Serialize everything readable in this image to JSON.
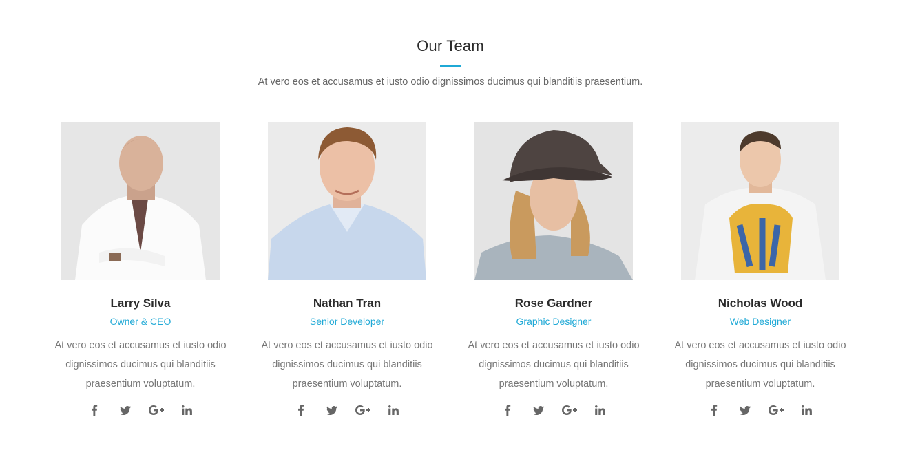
{
  "section": {
    "title": "Our Team",
    "subtitle": "At vero eos et accusamus et iusto odio dignissimos ducimus qui blanditiis praesentium.",
    "accent_color": "#1fa9d6"
  },
  "members": [
    {
      "name": "Larry Silva",
      "role": "Owner & CEO",
      "bio": "At vero eos et accusamus et iusto odio dignissimos ducimus qui blanditiis praesentium voluptatum.",
      "photo": "bald-man-white-shirt-tie-photo",
      "socials": [
        "facebook-icon",
        "twitter-icon",
        "google-plus-icon",
        "linkedin-icon"
      ]
    },
    {
      "name": "Nathan Tran",
      "role": "Senior Developer",
      "bio": "At vero eos et accusamus et iusto odio dignissimos ducimus qui blanditiis praesentium voluptatum.",
      "photo": "smiling-man-blue-shirt-photo",
      "socials": [
        "facebook-icon",
        "twitter-icon",
        "google-plus-icon",
        "linkedin-icon"
      ]
    },
    {
      "name": "Rose Gardner",
      "role": "Graphic Designer",
      "bio": "At vero eos et accusamus et iusto odio dignissimos ducimus qui blanditiis praesentium voluptatum.",
      "photo": "woman-dark-hat-blonde-hair-photo",
      "socials": [
        "facebook-icon",
        "twitter-icon",
        "google-plus-icon",
        "linkedin-icon"
      ]
    },
    {
      "name": "Nicholas Wood",
      "role": "Web Designer",
      "bio": "At vero eos et accusamus et iusto odio dignissimos ducimus qui blanditiis praesentium voluptatum.",
      "photo": "young-man-graphic-tshirt-photo",
      "socials": [
        "facebook-icon",
        "twitter-icon",
        "google-plus-icon",
        "linkedin-icon"
      ]
    }
  ]
}
